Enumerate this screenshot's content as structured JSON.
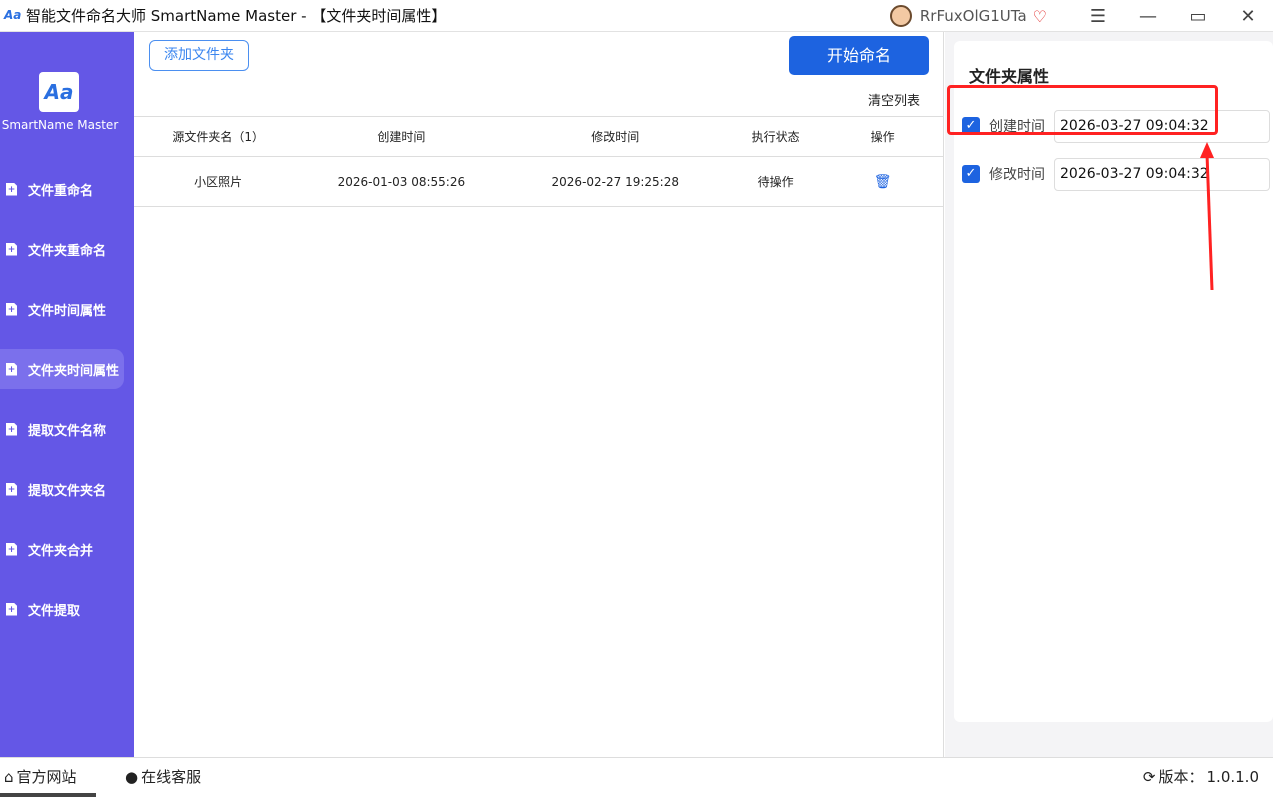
{
  "title": "智能文件命名大师 SmartName Master - 【文件夹时间属性】",
  "user": {
    "name": "RrFuxOlG1UTa"
  },
  "sidebar": {
    "logo_text": "SmartName Master",
    "items": [
      {
        "label": "文件重命名"
      },
      {
        "label": "文件夹重命名"
      },
      {
        "label": "文件时间属性"
      },
      {
        "label": "文件夹时间属性",
        "active": true
      },
      {
        "label": "提取文件名称"
      },
      {
        "label": "提取文件夹名"
      },
      {
        "label": "文件夹合并"
      },
      {
        "label": "文件提取"
      }
    ]
  },
  "main": {
    "add_folder": "添加文件夹",
    "start": "开始命名",
    "clear": "清空列表",
    "columns": [
      "源文件夹名（1）",
      "创建时间",
      "修改时间",
      "执行状态",
      "操作"
    ],
    "rows": [
      {
        "name": "小区照片",
        "created": "2026-01-03 08:55:26",
        "modified": "2026-02-27 19:25:28",
        "status": "待操作"
      }
    ]
  },
  "panel": {
    "title": "文件夹属性",
    "fields": [
      {
        "label": "创建时间",
        "value": "2026-03-27 09:04:32",
        "checked": true
      },
      {
        "label": "修改时间",
        "value": "2026-03-27 09:04:32",
        "checked": true
      }
    ]
  },
  "footer": {
    "website": "官方网站",
    "support": "在线客服",
    "version_label": "版本：",
    "version": "1.0.1.0"
  },
  "colors": {
    "sidebar": "#6457e6",
    "accent": "#1d63e0",
    "annotation": "#ff2222"
  }
}
